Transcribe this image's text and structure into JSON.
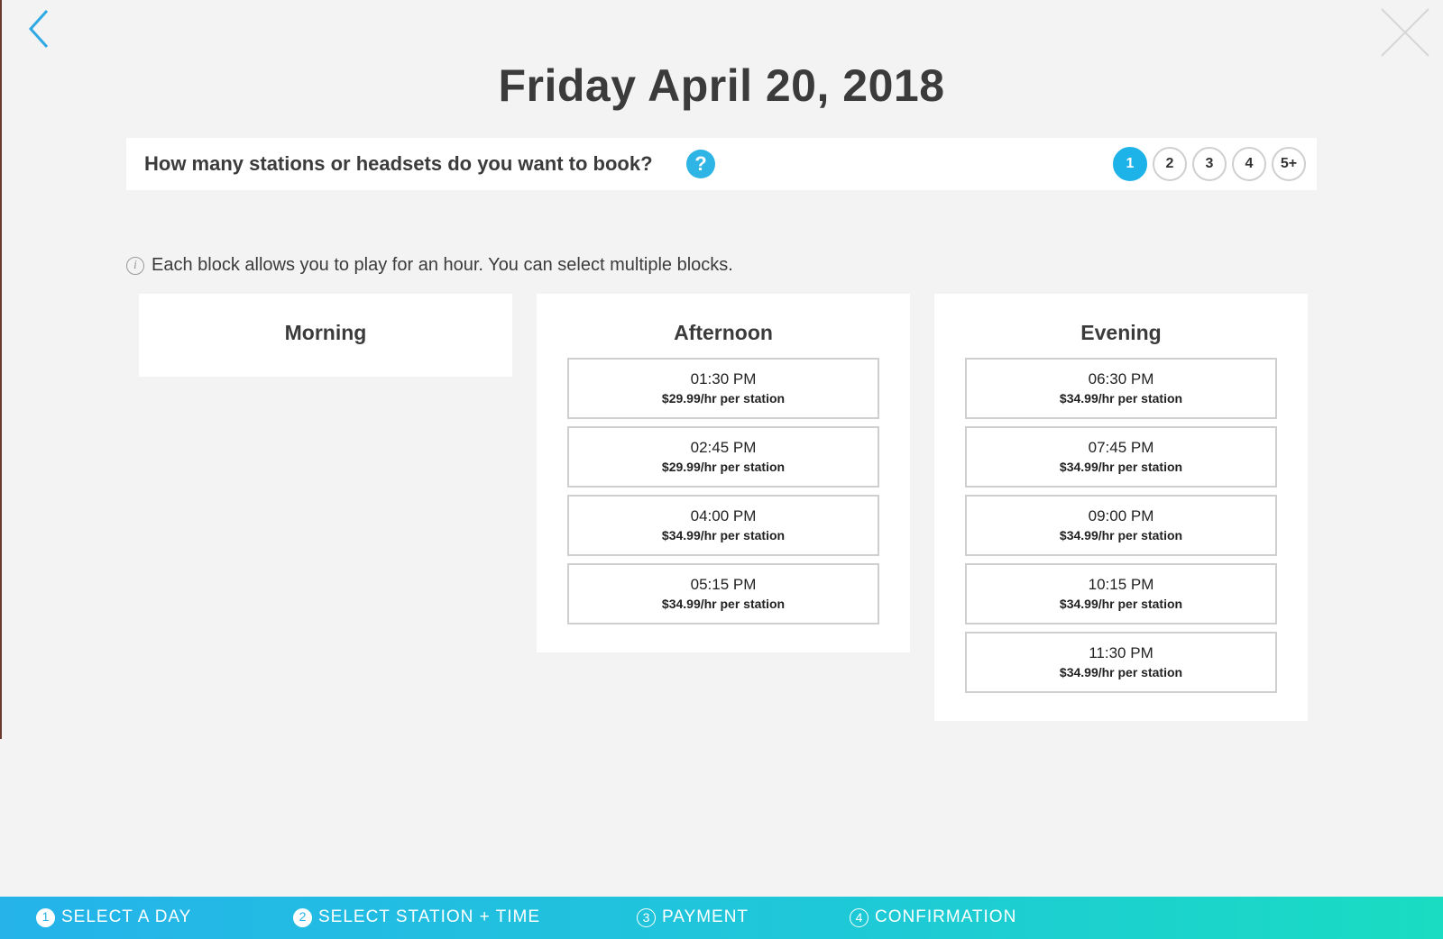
{
  "header": {
    "title": "Friday April 20, 2018",
    "back_icon": "chevron-left-icon",
    "close_icon": "close-icon"
  },
  "stations": {
    "question": "How many stations or headsets do you want to book?",
    "help_label": "?",
    "options": [
      "1",
      "2",
      "3",
      "4",
      "5+"
    ],
    "selected": "1"
  },
  "info": {
    "icon_label": "i",
    "text": "Each block allows you to play for an hour. You can select multiple blocks."
  },
  "periods": [
    {
      "title": "Morning",
      "slots": []
    },
    {
      "title": "Afternoon",
      "slots": [
        {
          "time": "01:30 PM",
          "price": "$29.99/hr per station"
        },
        {
          "time": "02:45 PM",
          "price": "$29.99/hr per station"
        },
        {
          "time": "04:00 PM",
          "price": "$34.99/hr per station"
        },
        {
          "time": "05:15 PM",
          "price": "$34.99/hr per station"
        }
      ]
    },
    {
      "title": "Evening",
      "slots": [
        {
          "time": "06:30 PM",
          "price": "$34.99/hr per station"
        },
        {
          "time": "07:45 PM",
          "price": "$34.99/hr per station"
        },
        {
          "time": "09:00 PM",
          "price": "$34.99/hr per station"
        },
        {
          "time": "10:15 PM",
          "price": "$34.99/hr per station"
        },
        {
          "time": "11:30 PM",
          "price": "$34.99/hr per station"
        }
      ]
    }
  ],
  "steps": [
    {
      "num": "1",
      "label": "SELECT A DAY",
      "state": "done"
    },
    {
      "num": "2",
      "label": "SELECT STATION + TIME",
      "state": "active"
    },
    {
      "num": "3",
      "label": "PAYMENT",
      "state": "pending"
    },
    {
      "num": "4",
      "label": "CONFIRMATION",
      "state": "pending"
    }
  ],
  "colors": {
    "accent": "#1eb3e8",
    "background": "#f3f3f3",
    "gradient_start": "#25b3ea",
    "gradient_end": "#19dcc2"
  }
}
